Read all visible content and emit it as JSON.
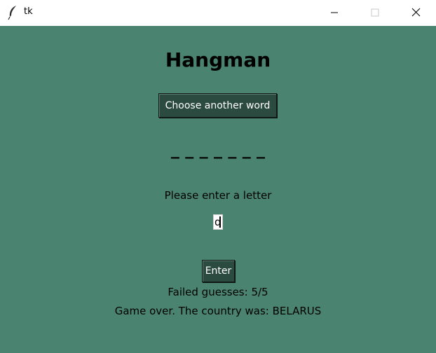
{
  "window": {
    "title": "tk",
    "icon": "feather-icon",
    "controls": {
      "minimize": "minimize-icon",
      "maximize": "maximize-icon",
      "close": "close-icon"
    }
  },
  "colors": {
    "background": "#4a8470",
    "button": "#2b4a40",
    "button_text": "#ffffff"
  },
  "game": {
    "heading": "Hangman",
    "choose_button_label": "Choose another word",
    "word_display": "_ _ _ _ _ _ _",
    "prompt": "Please enter a letter",
    "input_value": "q",
    "enter_button_label": "Enter",
    "failed_guesses": "Failed guesses: 5/5",
    "status": "Game over. The country was: BELARUS"
  }
}
